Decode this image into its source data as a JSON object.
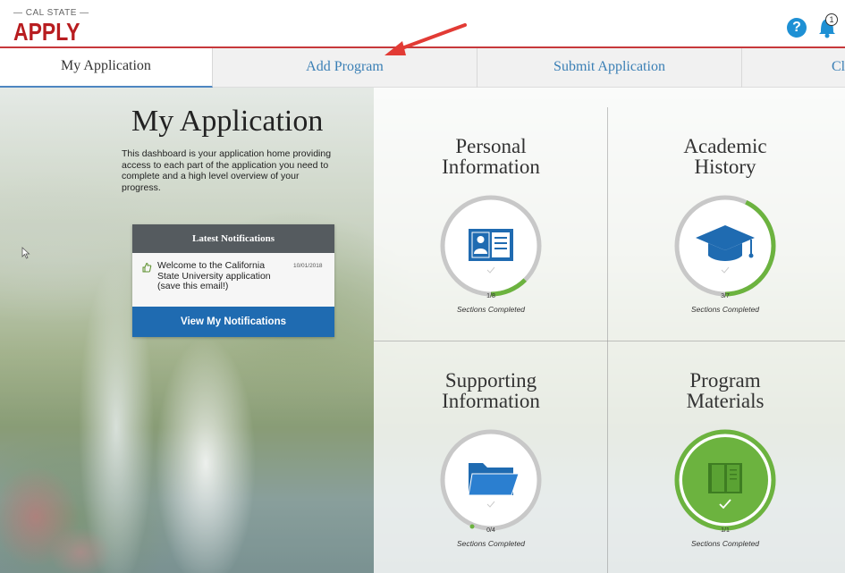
{
  "header": {
    "logo_top": "— CAL STATE —",
    "logo_main": "APPLY",
    "help_icon_glyph": "?",
    "notification_count": "1"
  },
  "tabs": [
    {
      "label": "My Application",
      "active": true
    },
    {
      "label": "Add Program",
      "active": false
    },
    {
      "label": "Submit Application",
      "active": false
    },
    {
      "label": "Cl",
      "active": false
    }
  ],
  "intro": {
    "title": "My Application",
    "description": "This dashboard is your application home providing access to each part of the application you need to complete and a high level overview of your progress."
  },
  "notifications": {
    "header": "Latest Notifications",
    "item_text": "Welcome to the California State University application (save this email!)",
    "item_date": "10/01/2018",
    "button_label": "View My Notifications"
  },
  "tiles": [
    {
      "title_line1": "Personal",
      "title_line2": "Information",
      "count": "1/8",
      "label": "Sections Completed",
      "progress": 0.125,
      "icon": "id-card-icon",
      "complete": false
    },
    {
      "title_line1": "Academic",
      "title_line2": "History",
      "count": "3/7",
      "label": "Sections Completed",
      "progress": 0.4286,
      "icon": "graduation-cap-icon",
      "complete": false
    },
    {
      "title_line1": "Supporting",
      "title_line2": "Information",
      "count": "0/4",
      "label": "Sections Completed",
      "progress": 0.0,
      "icon": "folder-icon",
      "complete": false
    },
    {
      "title_line1": "Program",
      "title_line2": "Materials",
      "count": "1/1",
      "label": "Sections Completed",
      "progress": 1.0,
      "icon": "book-icon",
      "complete": true
    }
  ],
  "colors": {
    "brand_red": "#b81d20",
    "progress_green": "#6cb33f",
    "ring_gray": "#c8c8c8",
    "icon_blue": "#1f6bb1",
    "tab_link": "#3a7fb5",
    "annotation_arrow": "#e23b35"
  }
}
